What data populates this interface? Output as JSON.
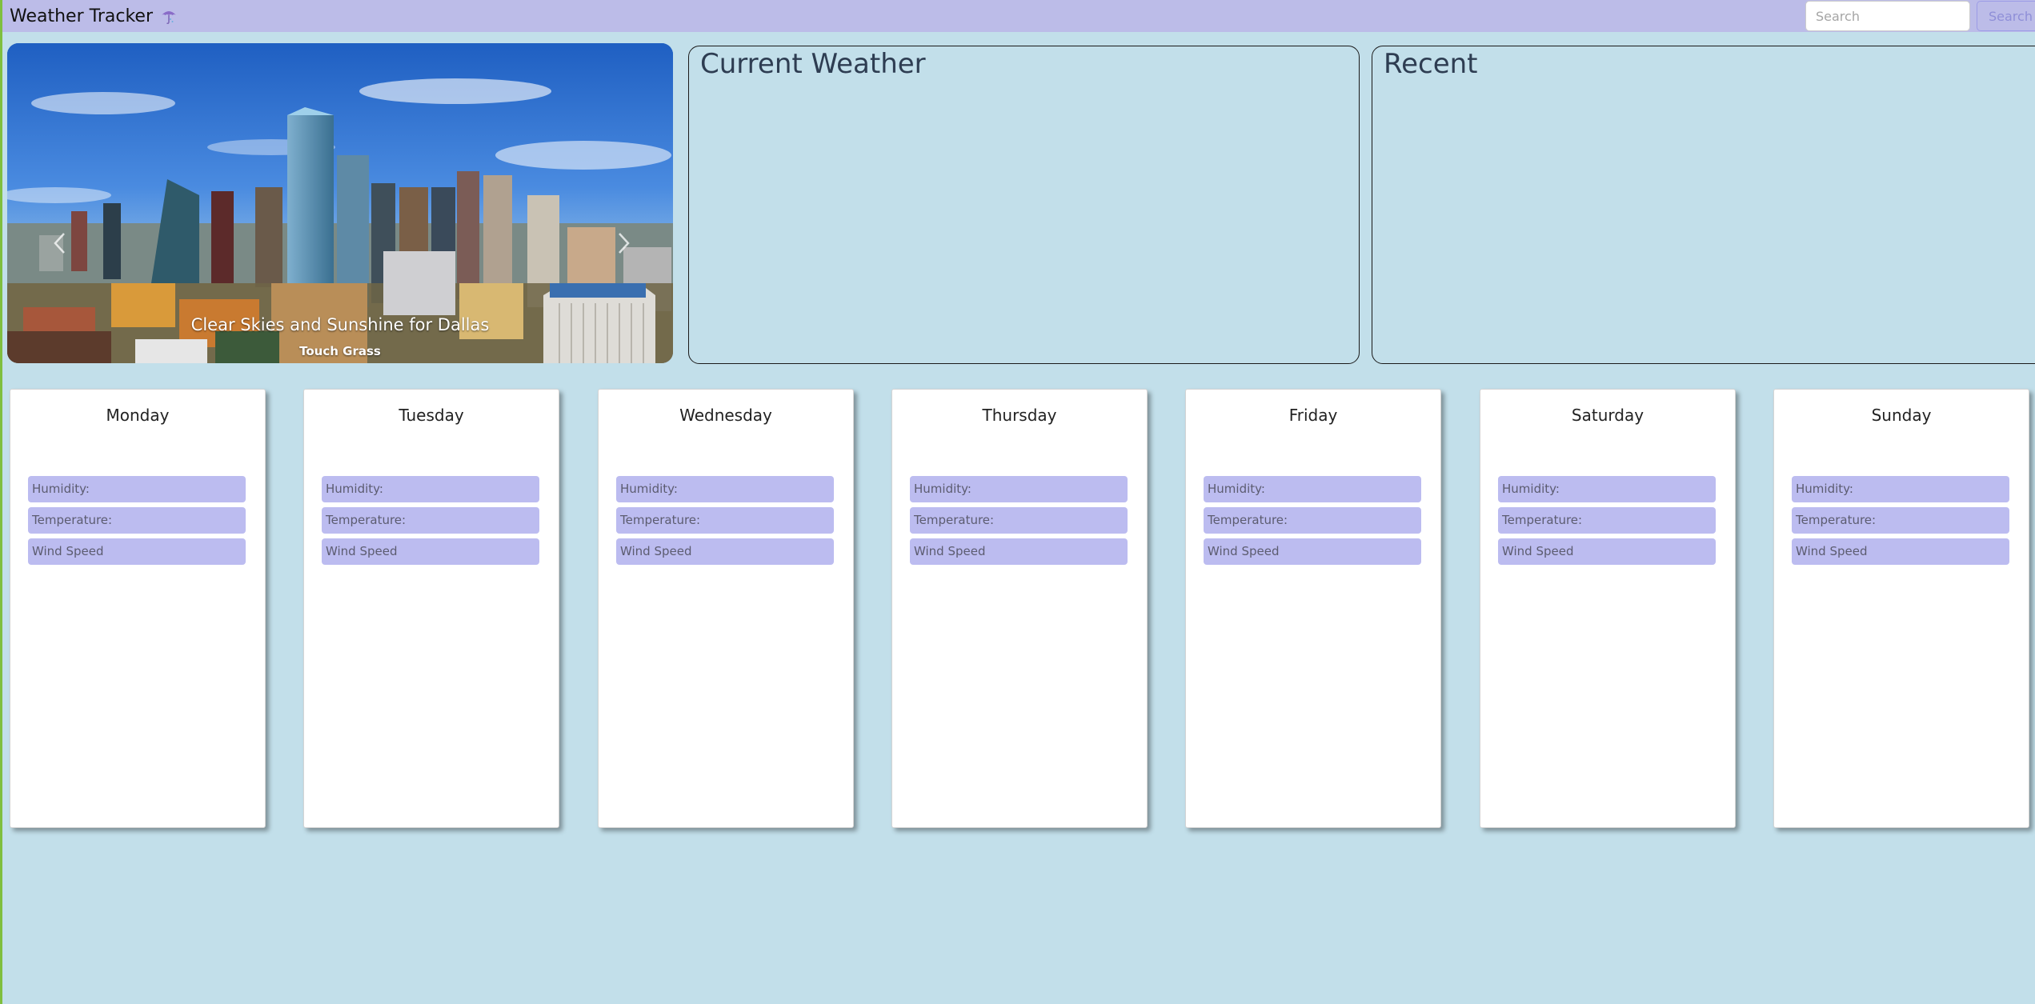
{
  "app": {
    "title": "Weather Tracker",
    "brand_icon": "umbrella-icon"
  },
  "search": {
    "placeholder": "Search",
    "button_label": "Search"
  },
  "carousel": {
    "caption_title": "Clear Skies and Sunshine for Dallas",
    "caption_subtitle": "Touch Grass",
    "slide_count": 3,
    "active_slide": 2,
    "prev_icon": "chevron-left-icon",
    "next_icon": "chevron-right-icon"
  },
  "panels": {
    "current_title": "Current Weather",
    "recent_title": "Recent"
  },
  "forecast": {
    "days": [
      {
        "name": "Monday",
        "humidity_label": "Humidity:",
        "temperature_label": "Temperature:",
        "wind_label": "Wind Speed"
      },
      {
        "name": "Tuesday",
        "humidity_label": "Humidity:",
        "temperature_label": "Temperature:",
        "wind_label": "Wind Speed"
      },
      {
        "name": "Wednesday",
        "humidity_label": "Humidity:",
        "temperature_label": "Temperature:",
        "wind_label": "Wind Speed"
      },
      {
        "name": "Thursday",
        "humidity_label": "Humidity:",
        "temperature_label": "Temperature:",
        "wind_label": "Wind Speed"
      },
      {
        "name": "Friday",
        "humidity_label": "Humidity:",
        "temperature_label": "Temperature:",
        "wind_label": "Wind Speed"
      },
      {
        "name": "Saturday",
        "humidity_label": "Humidity:",
        "temperature_label": "Temperature:",
        "wind_label": "Wind Speed"
      },
      {
        "name": "Sunday",
        "humidity_label": "Humidity:",
        "temperature_label": "Temperature:",
        "wind_label": "Wind Speed"
      }
    ]
  },
  "colors": {
    "page_background": "#c2dfea",
    "navbar_background": "#bcbce8",
    "stat_background": "#bcbcf0",
    "card_background": "#ffffff"
  }
}
